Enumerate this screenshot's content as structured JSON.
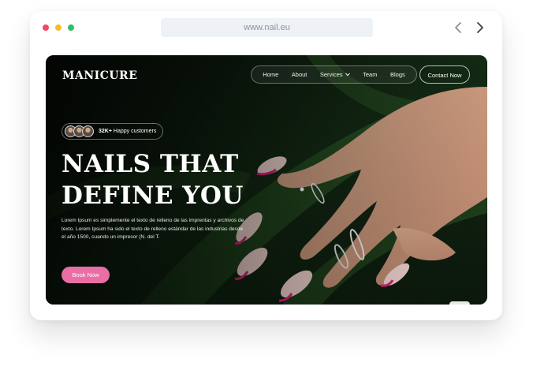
{
  "browser": {
    "url": "www.nail.eu",
    "icons": [
      "close-dot",
      "minimize-dot",
      "maximize-dot",
      "chevron-left-icon",
      "chevron-right-icon"
    ]
  },
  "site": {
    "logo": "MANICURE",
    "nav": {
      "home": "Home",
      "about": "About",
      "services": "Services",
      "team": "Team",
      "blogs": "Blogs"
    },
    "contact_label": "Contact Now"
  },
  "hero": {
    "customers_count": "32K+",
    "customers_text": "Happy customers",
    "title_line1": "NAILS THAT",
    "title_line2": "DEFINE YOU",
    "description": "Lorem Ipsum es simplemente el texto de relleno de las imprentas y archivos de texto. Lorem Ipsum ha sido el texto de relleno estándar de las industrias desde el año 1500, cuando un impresor (N. del T.",
    "cta_label": "Book Now"
  },
  "colors": {
    "accent_pink": "#e96ea5",
    "nail_tip": "#e0207a",
    "hero_dark": "#0d1a0e",
    "dot_red": "#ee4a67",
    "dot_yellow": "#f5be2f",
    "dot_green": "#2fbf6a"
  }
}
